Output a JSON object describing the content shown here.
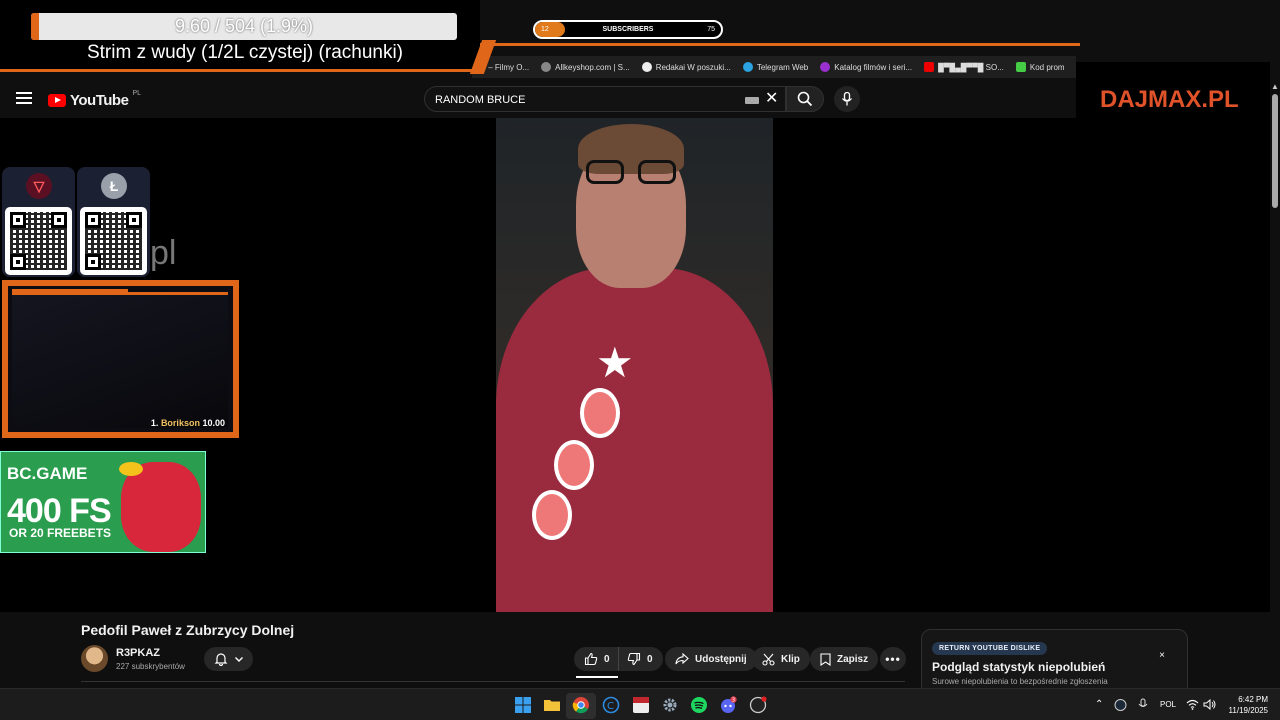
{
  "overlay": {
    "goal_text": "9.60 / 504 (1.9%)",
    "goal_fraction": 0.019,
    "stream_title": "Strim z wudy (1/2L czystej) (rachunki)",
    "subs_left": "12",
    "subs_label": "SUBSCRIBERS",
    "subs_right": "75",
    "subs_fraction": 0.16,
    "dajmax": "DAJMAX.PL",
    "ghost_text": "pl",
    "cam_rank_num": "1.",
    "cam_rank_name": "Borikson",
    "cam_rank_value": "10.00",
    "accent_color": "#e0661a"
  },
  "bookmarks": [
    {
      "label": "v – Filmy O...",
      "icon": "tv-icon"
    },
    {
      "label": "Allkeyshop.com | S...",
      "icon": "allkeyshop-icon"
    },
    {
      "label": "Redakai W poszuki...",
      "icon": "redakai-icon"
    },
    {
      "label": "Telegram Web",
      "icon": "telegram-icon"
    },
    {
      "label": "Katalog filmów i seri...",
      "icon": "katalog-icon"
    },
    {
      "label": "█▀█▄█▀▀█ SO...",
      "icon": "youtube-icon"
    },
    {
      "label": "Kod prom",
      "icon": "promo-icon"
    }
  ],
  "header": {
    "logo_text": "YouTube",
    "region": "PL",
    "search_value": "RANDOM BRUCE"
  },
  "ad": {
    "brand": "BC.GAME",
    "headline": "400 FS",
    "sub": "OR 20 FREEBETS"
  },
  "video": {
    "title": "Pedofil Paweł z Zubrzycy Dolnej",
    "channel": "R3PKAZ",
    "subscribers": "227 subskrybentów",
    "likes": "0",
    "dislikes": "0",
    "share": "Udostępnij",
    "clip": "Klip",
    "save": "Zapisz"
  },
  "rydl": {
    "badge": "RETURN YOUTUBE DISLIKE",
    "title": "Podgląd statystyk niepolubień",
    "subtitle": "Surowe niepolubienia to bezpośrednie zgłoszenia",
    "close": "×"
  },
  "taskbar": {
    "lang": "POL",
    "time": "6:42 PM",
    "date": "11/19/2025",
    "discord_badge": "3"
  }
}
